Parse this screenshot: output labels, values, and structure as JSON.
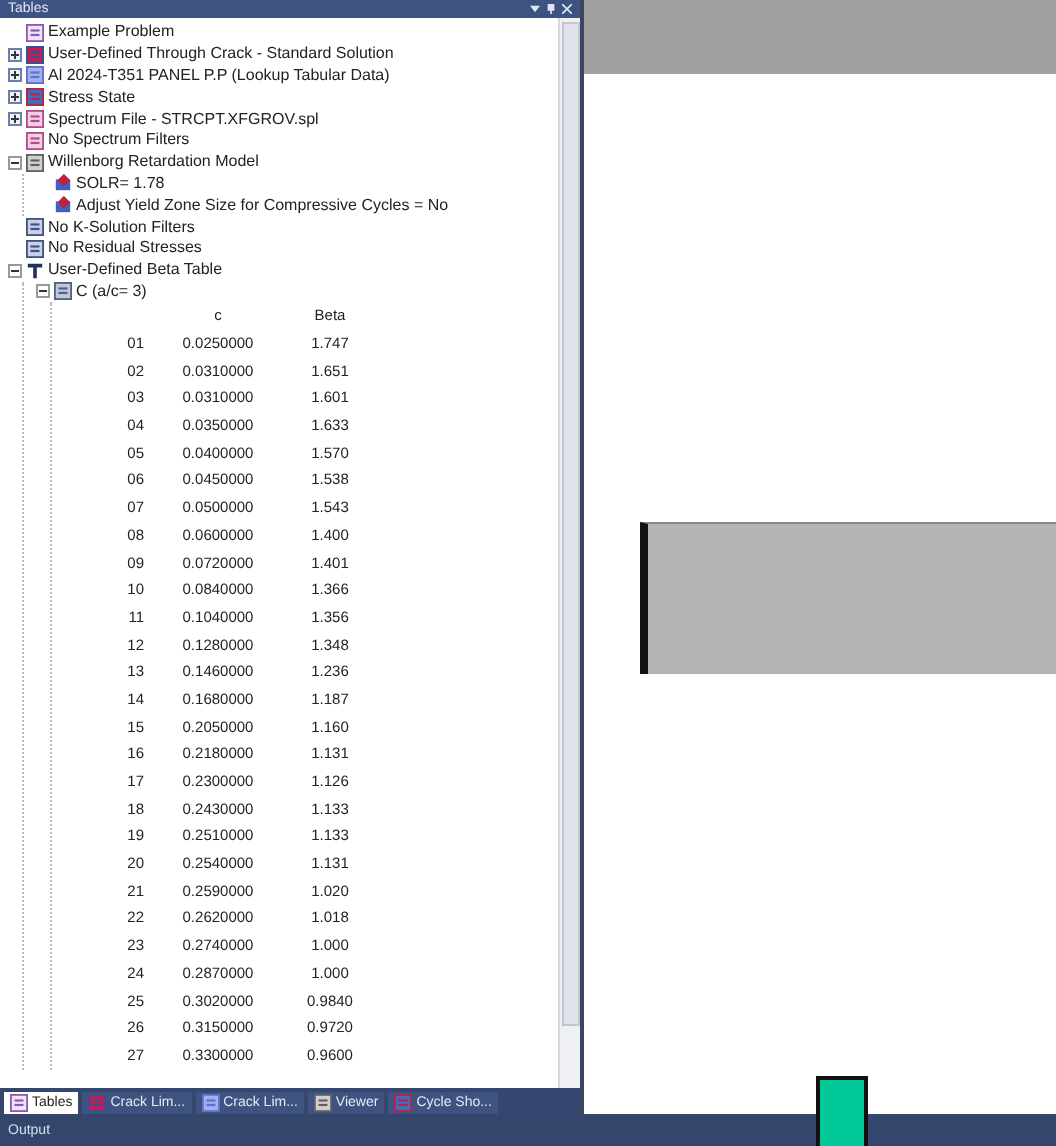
{
  "panel": {
    "title": "Tables"
  },
  "tree": [
    {
      "label": "Example Problem",
      "kind": "doc"
    },
    {
      "label": "User-Defined Through Crack - Standard Solution",
      "kind": "crack",
      "expanded": false
    },
    {
      "label": "Al 2024-T351 PANEL P.P (Lookup Tabular Data)",
      "kind": "material",
      "expanded": false
    },
    {
      "label": "Stress State",
      "kind": "stress",
      "expanded": false
    },
    {
      "label": "Spectrum File - STRCPT.XFGROV.spl",
      "kind": "spectrum",
      "expanded": false
    },
    {
      "label": "No Spectrum Filters",
      "kind": "spectrum"
    },
    {
      "label": "Willenborg Retardation Model",
      "kind": "model",
      "expanded": true,
      "children": [
        {
          "label": "SOLR= 1.78",
          "kind": "param"
        },
        {
          "label": "Adjust Yield Zone Size for Compressive Cycles = No",
          "kind": "param"
        }
      ]
    },
    {
      "label": "No K-Solution Filters",
      "kind": "filter"
    },
    {
      "label": "No Residual Stresses",
      "kind": "filter"
    },
    {
      "label": "User-Defined Beta Table",
      "kind": "beta",
      "expanded": true,
      "children": [
        {
          "label": "C (a/c= 3)",
          "kind": "grid",
          "expanded": true,
          "table": {
            "columns": [
              "c",
              "Beta"
            ],
            "rows": [
              {
                "index": "01",
                "c": "0.0250000",
                "beta": "1.747"
              },
              {
                "index": "02",
                "c": "0.0310000",
                "beta": "1.651"
              },
              {
                "index": "03",
                "c": "0.0310000",
                "beta": "1.601"
              },
              {
                "index": "04",
                "c": "0.0350000",
                "beta": "1.633"
              },
              {
                "index": "05",
                "c": "0.0400000",
                "beta": "1.570"
              },
              {
                "index": "06",
                "c": "0.0450000",
                "beta": "1.538"
              },
              {
                "index": "07",
                "c": "0.0500000",
                "beta": "1.543"
              },
              {
                "index": "08",
                "c": "0.0600000",
                "beta": "1.400"
              },
              {
                "index": "09",
                "c": "0.0720000",
                "beta": "1.401"
              },
              {
                "index": "10",
                "c": "0.0840000",
                "beta": "1.366"
              },
              {
                "index": "11",
                "c": "0.1040000",
                "beta": "1.356"
              },
              {
                "index": "12",
                "c": "0.1280000",
                "beta": "1.348"
              },
              {
                "index": "13",
                "c": "0.1460000",
                "beta": "1.236"
              },
              {
                "index": "14",
                "c": "0.1680000",
                "beta": "1.187"
              },
              {
                "index": "15",
                "c": "0.2050000",
                "beta": "1.160"
              },
              {
                "index": "16",
                "c": "0.2180000",
                "beta": "1.131"
              },
              {
                "index": "17",
                "c": "0.2300000",
                "beta": "1.126"
              },
              {
                "index": "18",
                "c": "0.2430000",
                "beta": "1.133"
              },
              {
                "index": "19",
                "c": "0.2510000",
                "beta": "1.133"
              },
              {
                "index": "20",
                "c": "0.2540000",
                "beta": "1.131"
              },
              {
                "index": "21",
                "c": "0.2590000",
                "beta": "1.020"
              },
              {
                "index": "22",
                "c": "0.2620000",
                "beta": "1.018"
              },
              {
                "index": "23",
                "c": "0.2740000",
                "beta": "1.000"
              },
              {
                "index": "24",
                "c": "0.2870000",
                "beta": "1.000"
              },
              {
                "index": "25",
                "c": "0.3020000",
                "beta": "0.9840"
              },
              {
                "index": "26",
                "c": "0.3150000",
                "beta": "0.9720"
              },
              {
                "index": "27",
                "c": "0.3300000",
                "beta": "0.9600"
              }
            ]
          }
        }
      ]
    }
  ],
  "tabs": [
    {
      "label": "Tables",
      "kind": "doc",
      "selected": true
    },
    {
      "label": "Crack Lim...",
      "kind": "crack",
      "selected": false
    },
    {
      "label": "Crack Lim...",
      "kind": "material",
      "selected": false
    },
    {
      "label": "Viewer",
      "kind": "model",
      "selected": false
    },
    {
      "label": "Cycle Sho...",
      "kind": "stress",
      "selected": false
    }
  ],
  "output": {
    "title": "Output"
  }
}
